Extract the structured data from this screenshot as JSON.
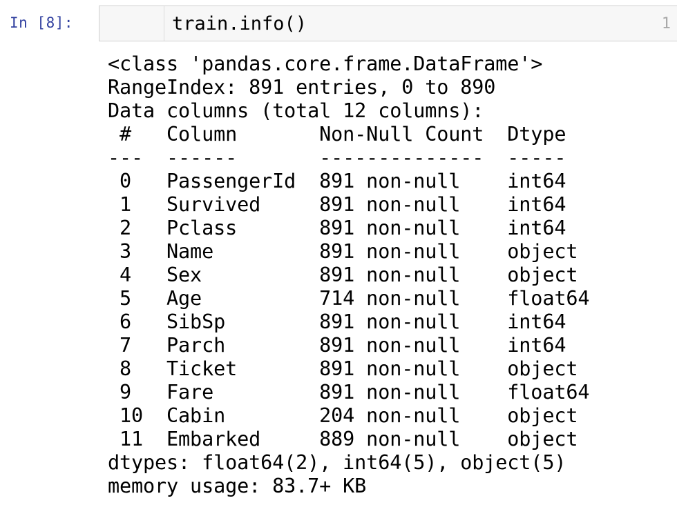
{
  "cell": {
    "prompt_label": "In [8]:",
    "prompt_color": "#303f9f",
    "line_number": "1",
    "code": "train.info()",
    "cell_background": "#f7f7f7",
    "cell_border_color": "#cfcfcf"
  },
  "output": {
    "class_line": "<class 'pandas.core.frame.DataFrame'>",
    "index_line": "RangeIndex: 891 entries, 0 to 890",
    "columns_line": "Data columns (total 12 columns):",
    "header_line": " #   Column       Non-Null Count  Dtype  ",
    "separator_line": "---  ------       --------------  -----  ",
    "dtypes_line": "dtypes: float64(2), int64(5), object(5)",
    "memory_line": "memory usage: 83.7+ KB",
    "table_headers": [
      "#",
      "Column",
      "Non-Null Count",
      "Dtype"
    ],
    "rows": [
      {
        "line": " 0   PassengerId  891 non-null    int64  ",
        "index": "0",
        "column": "PassengerId",
        "non_null_count": "891 non-null",
        "dtype": "int64"
      },
      {
        "line": " 1   Survived     891 non-null    int64  ",
        "index": "1",
        "column": "Survived",
        "non_null_count": "891 non-null",
        "dtype": "int64"
      },
      {
        "line": " 2   Pclass       891 non-null    int64  ",
        "index": "2",
        "column": "Pclass",
        "non_null_count": "891 non-null",
        "dtype": "int64"
      },
      {
        "line": " 3   Name         891 non-null    object ",
        "index": "3",
        "column": "Name",
        "non_null_count": "891 non-null",
        "dtype": "object"
      },
      {
        "line": " 4   Sex          891 non-null    object ",
        "index": "4",
        "column": "Sex",
        "non_null_count": "891 non-null",
        "dtype": "object"
      },
      {
        "line": " 5   Age          714 non-null    float64",
        "index": "5",
        "column": "Age",
        "non_null_count": "714 non-null",
        "dtype": "float64"
      },
      {
        "line": " 6   SibSp        891 non-null    int64  ",
        "index": "6",
        "column": "SibSp",
        "non_null_count": "891 non-null",
        "dtype": "int64"
      },
      {
        "line": " 7   Parch        891 non-null    int64  ",
        "index": "7",
        "column": "Parch",
        "non_null_count": "891 non-null",
        "dtype": "int64"
      },
      {
        "line": " 8   Ticket       891 non-null    object ",
        "index": "8",
        "column": "Ticket",
        "non_null_count": "891 non-null",
        "dtype": "object"
      },
      {
        "line": " 9   Fare         891 non-null    float64",
        "index": "9",
        "column": "Fare",
        "non_null_count": "891 non-null",
        "dtype": "float64"
      },
      {
        "line": " 10  Cabin        204 non-null    object ",
        "index": "10",
        "column": "Cabin",
        "non_null_count": "204 non-null",
        "dtype": "object"
      },
      {
        "line": " 11  Embarked     889 non-null    object ",
        "index": "11",
        "column": "Embarked",
        "non_null_count": "889 non-null",
        "dtype": "object"
      }
    ]
  }
}
